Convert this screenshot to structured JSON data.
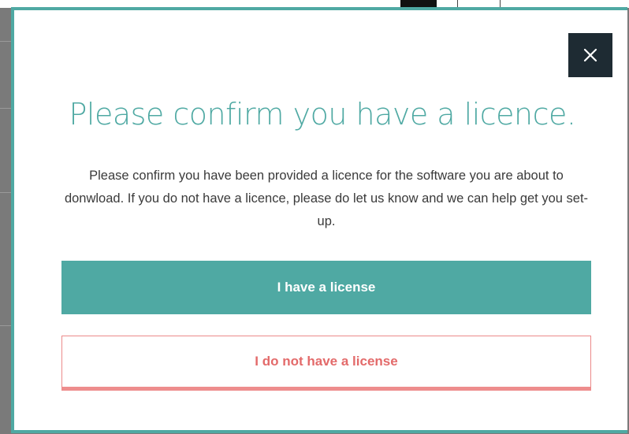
{
  "modal": {
    "title": "Please confirm you have a licence.",
    "message": "Please confirm you have been provided a licence for the software you are about to donwload. If you do not have a licence, please do let us know and we can help get you set-up.",
    "close_icon": "close-icon",
    "primary_button_label": "I have a license",
    "secondary_button_label": "I do not have a license"
  },
  "colors": {
    "accent": "#4fa9a3",
    "close_bg": "#1e2b33",
    "danger": "#e36a6a"
  }
}
